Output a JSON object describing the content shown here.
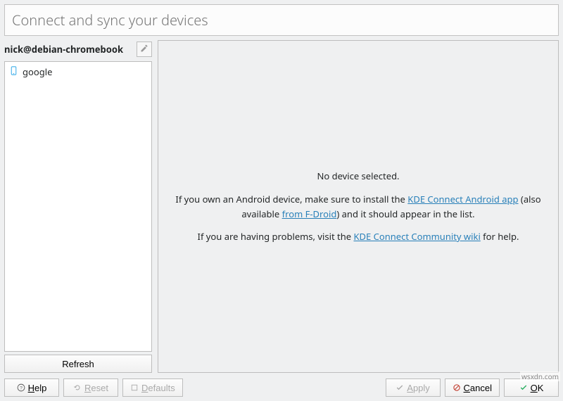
{
  "title": "Connect and sync your devices",
  "host": "nick@debian-chromebook",
  "devices": [
    {
      "name": "google"
    }
  ],
  "refresh_label": "Refresh",
  "main": {
    "no_device": "No device selected.",
    "line1_before": "If you own an Android device, make sure to install the ",
    "link1": "KDE Connect Android app",
    "line1_mid": " (also available ",
    "link2": "from F-Droid",
    "line1_after": ") and it should appear in the list.",
    "line2_before": "If you are having problems, visit the ",
    "link3": "KDE Connect Community wiki",
    "line2_after": " for help."
  },
  "buttons": {
    "help": "Help",
    "reset": "Reset",
    "defaults": "Defaults",
    "apply": "Apply",
    "cancel": "Cancel",
    "ok": "OK"
  },
  "watermark": "wsxdn.com"
}
